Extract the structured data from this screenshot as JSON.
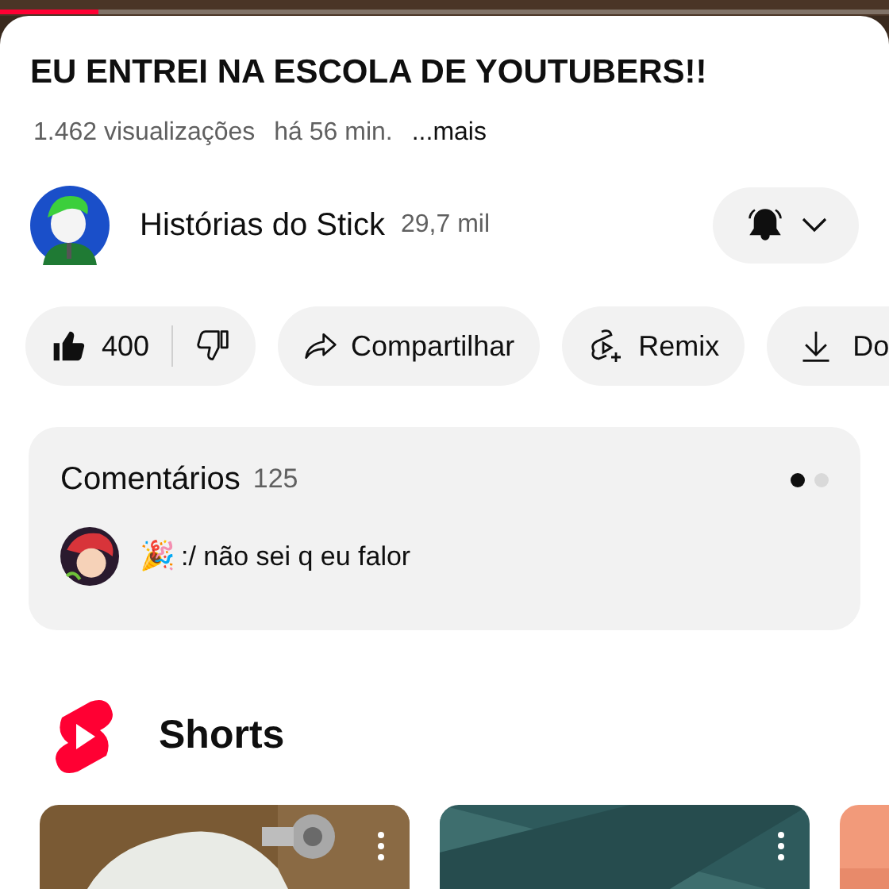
{
  "player": {
    "progress": {
      "level": 0.11
    }
  },
  "video": {
    "title": "EU ENTREI NA ESCOLA DE YOUTUBERS!!",
    "views": "1.462 visualizações",
    "age": "há 56 min.",
    "more": "...mais"
  },
  "channel": {
    "name": "Histórias do Stick",
    "subscribers": "29,7 mil",
    "notifications": true
  },
  "actions": [
    {
      "kind": "like",
      "likes": "400"
    },
    {
      "kind": "share",
      "label": "Compartilhar"
    },
    {
      "kind": "remix",
      "label": "Remix"
    },
    {
      "kind": "download",
      "label": "Do"
    }
  ],
  "comments": {
    "title": "Comentários",
    "count": "125",
    "pages": [
      {
        "selected": true
      },
      {
        "selected": false
      }
    ],
    "top_comment": {
      "emoji": "🎉",
      "text": ":/ não sei q eu falor"
    }
  },
  "shorts": {
    "title": "Shorts",
    "items": [
      {
        "kind": "picture",
        "menu": true
      },
      {
        "kind": "picture",
        "menu": true
      },
      {
        "kind": "picture",
        "menu": false
      }
    ]
  }
}
